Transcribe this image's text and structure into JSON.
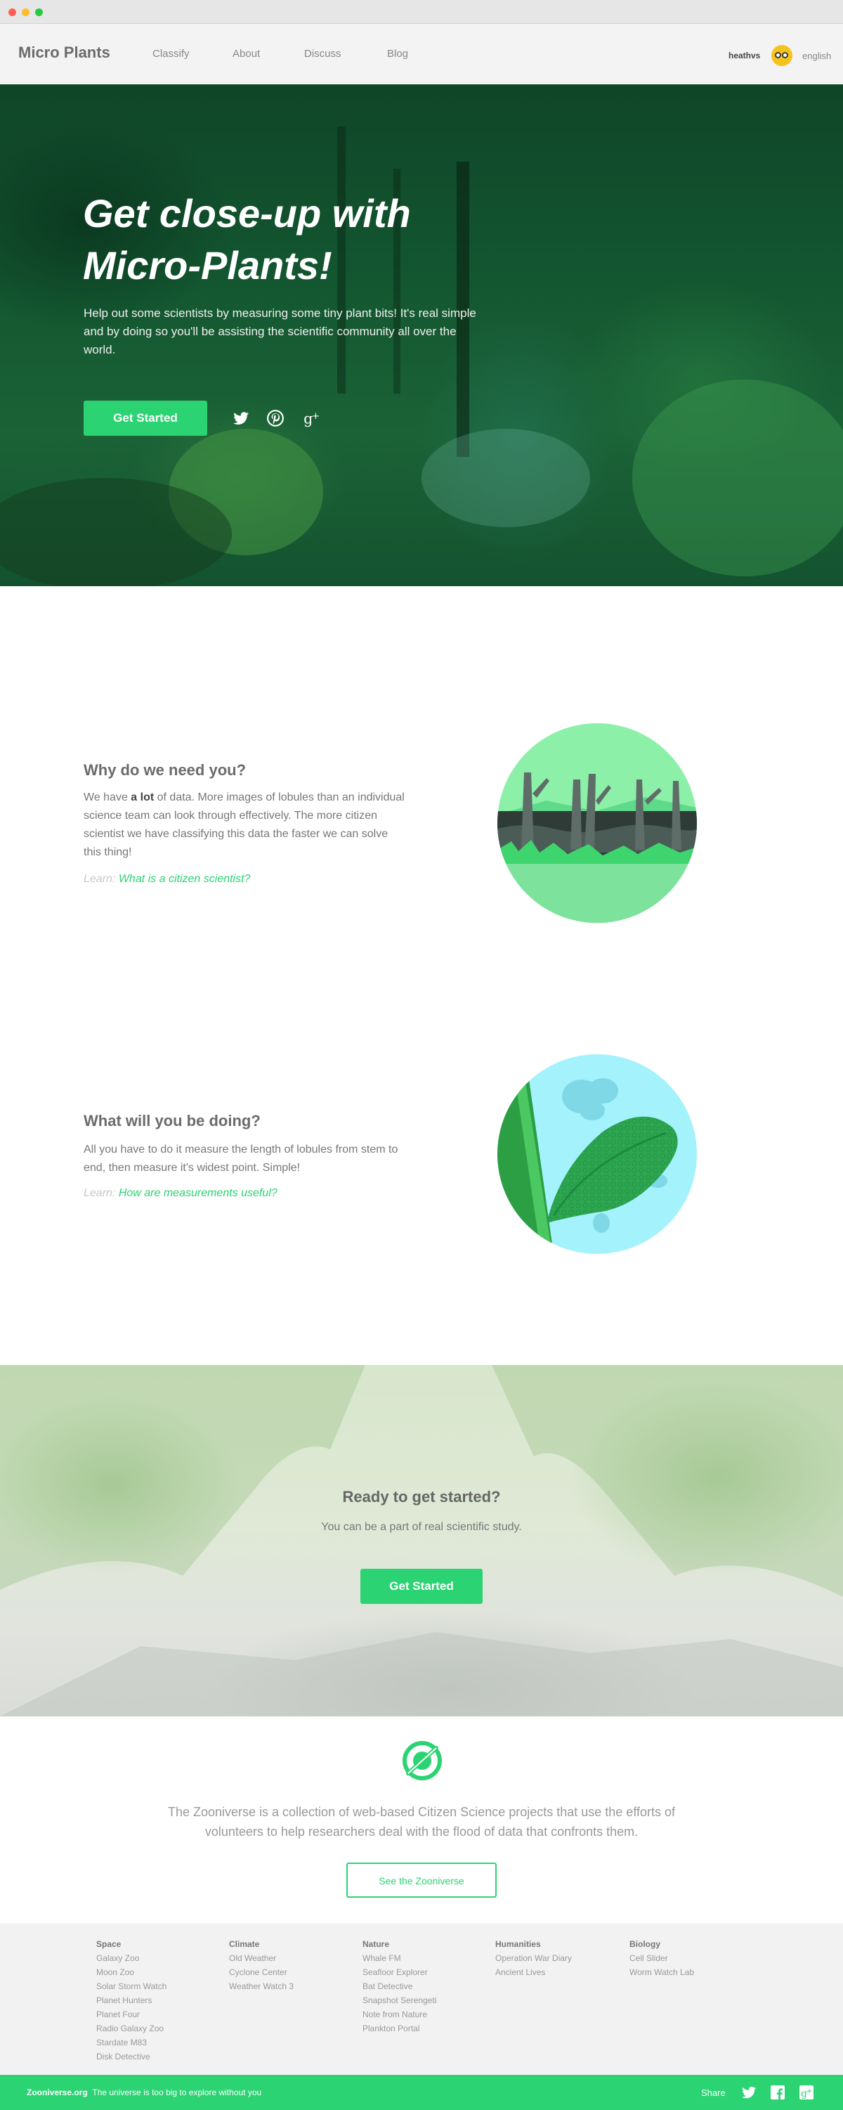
{
  "nav": {
    "brand": "Micro Plants",
    "links": [
      "Classify",
      "About",
      "Discuss",
      "Blog"
    ],
    "user": "heathvs",
    "language": "english"
  },
  "hero": {
    "title": "Get close-up with Micro-Plants!",
    "text": "Help out some scientists by measuring some tiny plant bits! It's real simple and by doing so you'll be assisting the scientific community all over the world.",
    "button": "Get Started",
    "social_icons": [
      "twitter-icon",
      "pinterest-icon",
      "google-plus-icon"
    ]
  },
  "why": {
    "heading": "Why do we need you?",
    "text_before": "We have ",
    "text_bold": "a lot",
    "text_after": " of data. More images of lobules than an individual science team can look through effectively. The more citizen scientist we have classifying this data the faster we can solve this thing!",
    "learn_prefix": "Learn:",
    "learn_link": "What is a citizen scientist?"
  },
  "doing": {
    "heading": "What will you be doing?",
    "text": "All you have to do it measure the length of lobules from stem to end, then measure it's widest point. Simple!",
    "learn_prefix": "Learn:",
    "learn_link": "How are measurements useful?"
  },
  "cta": {
    "title": "Ready to get started?",
    "subtitle": "You can be a part of real scientific study.",
    "button": "Get Started"
  },
  "zooniverse": {
    "text": "The Zooniverse is a collection of web-based Citizen Science projects that use the efforts of volunteers to help researchers deal with the flood of data that confronts them.",
    "button": "See the Zooniverse"
  },
  "footer": {
    "columns": [
      {
        "heading": "Space",
        "items": [
          "Galaxy Zoo",
          "Moon Zoo",
          "Solar Storm Watch",
          "Planet Hunters",
          "Planet Four",
          "Radio Galaxy Zoo",
          "Stardate M83",
          "Disk Detective"
        ]
      },
      {
        "heading": "Climate",
        "items": [
          "Old Weather",
          "Cyclone Center",
          "Weather Watch 3"
        ]
      },
      {
        "heading": "Nature",
        "items": [
          "Whale FM",
          "Seafloor Explorer",
          "Bat Detective",
          "Snapshot Serengeti",
          "Note from Nature",
          "Plankton Portal"
        ]
      },
      {
        "heading": "Humanities",
        "items": [
          "Operation War Diary",
          "Ancient Lives"
        ]
      },
      {
        "heading": "Biology",
        "items": [
          "Cell Slider",
          "Worm Watch Lab"
        ]
      }
    ],
    "site": "Zooniverse.org",
    "tagline": "The universe is too big to explore without you",
    "share": "Share",
    "share_icons": [
      "twitter-icon",
      "facebook-icon",
      "google-plus-icon"
    ]
  },
  "colors": {
    "accent": "#2bd373",
    "hero_overlay": "#12502c",
    "text_muted": "#777777"
  }
}
